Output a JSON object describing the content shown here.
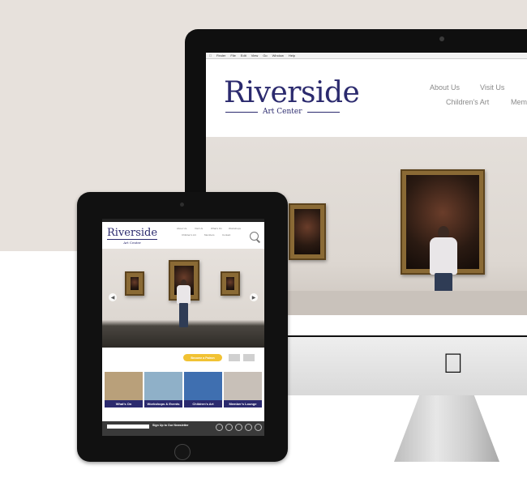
{
  "desktop_site": {
    "mac_menu": [
      "Finder",
      "File",
      "Edit",
      "View",
      "Go",
      "Window",
      "Help"
    ],
    "logo_word": "Riverside",
    "logo_sub": "Art Center",
    "nav": {
      "about": "About Us",
      "visit": "Visit Us",
      "children": "Children's Art",
      "members": "Mem"
    }
  },
  "tablet_site": {
    "logo_word": "Riverside",
    "logo_sub": "Art Center",
    "nav": {
      "about": "About Us",
      "visit": "Visit Us",
      "whats_on": "What's On",
      "workshops": "Workshops",
      "children": "Children's Art",
      "members": "Members",
      "contact": "Contact"
    },
    "patron_button": "Become a Patron",
    "tiles": [
      {
        "label": "What's On",
        "color": "#b9a07a"
      },
      {
        "label": "Workshops & Events",
        "color": "#8fb0c8"
      },
      {
        "label": "Children's Art",
        "color": "#3f6fb0"
      },
      {
        "label": "Member's Lounge",
        "color": "#c8c0b8"
      }
    ],
    "newsletter_label": "Sign Up to Our Newsletter"
  },
  "colors": {
    "brand": "#2b2a6e",
    "accent": "#f1c233",
    "backdrop": "#e7e1dc"
  }
}
